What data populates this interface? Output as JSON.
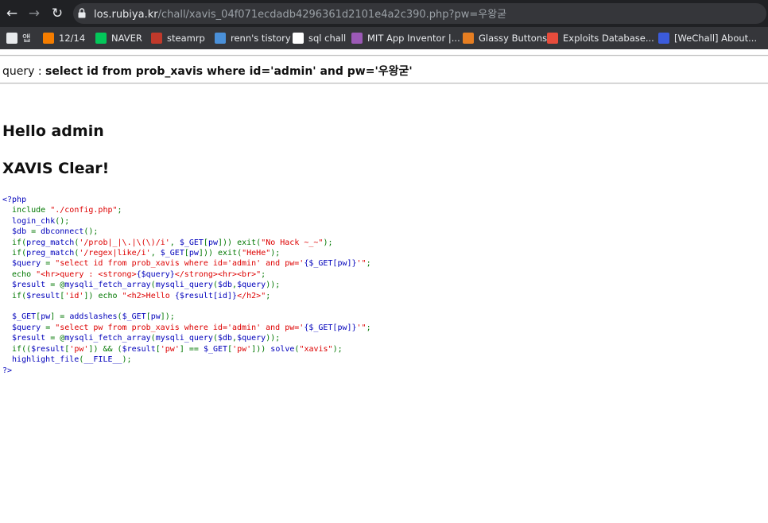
{
  "browser": {
    "nav": {
      "back": "←",
      "forward": "→",
      "reload": "↻"
    },
    "url_host": "los.rubiya.kr",
    "url_path": "/chall/xavis_04f071ecdadb4296361d2101e4a2c390.php?pw=우왕굳"
  },
  "bookmarks": [
    {
      "icon": "apps-grid-icon",
      "label": "앱",
      "color": "#e8eaed"
    },
    {
      "icon": "blogger-icon",
      "label": "12/14",
      "color": "#f57d00"
    },
    {
      "icon": "naver-icon",
      "label": "NAVER",
      "color": "#03c75a"
    },
    {
      "icon": "steam-icon",
      "label": "steamrp",
      "color": "#c0392b"
    },
    {
      "icon": "tistory-icon",
      "label": "renn's tistory",
      "color": "#4a90d9"
    },
    {
      "icon": "z-icon",
      "label": "sql chall",
      "color": "#ffffff"
    },
    {
      "icon": "mit-app-inventor-icon",
      "label": "MIT App Inventor |...",
      "color": "#9b59b6"
    },
    {
      "icon": "glassy-buttons-icon",
      "label": "Glassy Buttons",
      "color": "#e67e22"
    },
    {
      "icon": "exploit-db-icon",
      "label": "Exploits Database...",
      "color": "#e74c3c"
    },
    {
      "icon": "wechall-icon",
      "label": "[WeChall] About...",
      "color": "#3b5bdb"
    }
  ],
  "page": {
    "query_label": "query : ",
    "query_value": "select id from prob_xavis where id='admin' and pw='우왕굳'",
    "hello": "Hello admin",
    "clear": "XAVIS Clear!"
  },
  "source": {
    "lines": [
      [
        {
          "t": "<?php",
          "c": "def"
        }
      ],
      [
        {
          "t": "  include ",
          "c": "key"
        },
        {
          "t": "\"./config.php\"",
          "c": "str"
        },
        {
          "t": ";",
          "c": "key"
        }
      ],
      [
        {
          "t": "  login_chk",
          "c": "def"
        },
        {
          "t": "();",
          "c": "key"
        }
      ],
      [
        {
          "t": "  $db ",
          "c": "def"
        },
        {
          "t": "= ",
          "c": "key"
        },
        {
          "t": "dbconnect",
          "c": "def"
        },
        {
          "t": "();",
          "c": "key"
        }
      ],
      [
        {
          "t": "  if",
          "c": "key"
        },
        {
          "t": "(",
          "c": "key"
        },
        {
          "t": "preg_match",
          "c": "def"
        },
        {
          "t": "(",
          "c": "key"
        },
        {
          "t": "'/prob|_|\\.|\\(\\)/i'",
          "c": "str"
        },
        {
          "t": ", ",
          "c": "key"
        },
        {
          "t": "$_GET",
          "c": "def"
        },
        {
          "t": "[",
          "c": "key"
        },
        {
          "t": "pw",
          "c": "def"
        },
        {
          "t": "])) exit(",
          "c": "key"
        },
        {
          "t": "\"No Hack ~_~\"",
          "c": "str"
        },
        {
          "t": ");",
          "c": "key"
        }
      ],
      [
        {
          "t": "  if",
          "c": "key"
        },
        {
          "t": "(",
          "c": "key"
        },
        {
          "t": "preg_match",
          "c": "def"
        },
        {
          "t": "(",
          "c": "key"
        },
        {
          "t": "'/regex|like/i'",
          "c": "str"
        },
        {
          "t": ", ",
          "c": "key"
        },
        {
          "t": "$_GET",
          "c": "def"
        },
        {
          "t": "[",
          "c": "key"
        },
        {
          "t": "pw",
          "c": "def"
        },
        {
          "t": "])) exit(",
          "c": "key"
        },
        {
          "t": "\"HeHe\"",
          "c": "str"
        },
        {
          "t": ");",
          "c": "key"
        }
      ],
      [
        {
          "t": "  $query ",
          "c": "def"
        },
        {
          "t": "= ",
          "c": "key"
        },
        {
          "t": "\"select id from prob_xavis where id='admin' and pw='",
          "c": "str"
        },
        {
          "t": "{$_GET[pw]}",
          "c": "def"
        },
        {
          "t": "'\"",
          "c": "str"
        },
        {
          "t": ";",
          "c": "key"
        }
      ],
      [
        {
          "t": "  echo ",
          "c": "key"
        },
        {
          "t": "\"<hr>query : <strong>",
          "c": "str"
        },
        {
          "t": "{$query}",
          "c": "def"
        },
        {
          "t": "</strong><hr><br>\"",
          "c": "str"
        },
        {
          "t": ";",
          "c": "key"
        }
      ],
      [
        {
          "t": "  $result ",
          "c": "def"
        },
        {
          "t": "= @",
          "c": "key"
        },
        {
          "t": "mysqli_fetch_array",
          "c": "def"
        },
        {
          "t": "(",
          "c": "key"
        },
        {
          "t": "mysqli_query",
          "c": "def"
        },
        {
          "t": "(",
          "c": "key"
        },
        {
          "t": "$db",
          "c": "def"
        },
        {
          "t": ",",
          "c": "key"
        },
        {
          "t": "$query",
          "c": "def"
        },
        {
          "t": "));",
          "c": "key"
        }
      ],
      [
        {
          "t": "  if",
          "c": "key"
        },
        {
          "t": "(",
          "c": "key"
        },
        {
          "t": "$result",
          "c": "def"
        },
        {
          "t": "[",
          "c": "key"
        },
        {
          "t": "'id'",
          "c": "str"
        },
        {
          "t": "]) echo ",
          "c": "key"
        },
        {
          "t": "\"<h2>Hello ",
          "c": "str"
        },
        {
          "t": "{$result[id]}",
          "c": "def"
        },
        {
          "t": "</h2>\"",
          "c": "str"
        },
        {
          "t": ";",
          "c": "key"
        }
      ],
      [
        {
          "t": "",
          "c": "def"
        }
      ],
      [
        {
          "t": "  $_GET",
          "c": "def"
        },
        {
          "t": "[",
          "c": "key"
        },
        {
          "t": "pw",
          "c": "def"
        },
        {
          "t": "] = ",
          "c": "key"
        },
        {
          "t": "addslashes",
          "c": "def"
        },
        {
          "t": "(",
          "c": "key"
        },
        {
          "t": "$_GET",
          "c": "def"
        },
        {
          "t": "[",
          "c": "key"
        },
        {
          "t": "pw",
          "c": "def"
        },
        {
          "t": "]);",
          "c": "key"
        }
      ],
      [
        {
          "t": "  $query ",
          "c": "def"
        },
        {
          "t": "= ",
          "c": "key"
        },
        {
          "t": "\"select pw from prob_xavis where id='admin' and pw='",
          "c": "str"
        },
        {
          "t": "{$_GET[pw]}",
          "c": "def"
        },
        {
          "t": "'\"",
          "c": "str"
        },
        {
          "t": ";",
          "c": "key"
        }
      ],
      [
        {
          "t": "  $result ",
          "c": "def"
        },
        {
          "t": "= @",
          "c": "key"
        },
        {
          "t": "mysqli_fetch_array",
          "c": "def"
        },
        {
          "t": "(",
          "c": "key"
        },
        {
          "t": "mysqli_query",
          "c": "def"
        },
        {
          "t": "(",
          "c": "key"
        },
        {
          "t": "$db",
          "c": "def"
        },
        {
          "t": ",",
          "c": "key"
        },
        {
          "t": "$query",
          "c": "def"
        },
        {
          "t": "));",
          "c": "key"
        }
      ],
      [
        {
          "t": "  if",
          "c": "key"
        },
        {
          "t": "((",
          "c": "key"
        },
        {
          "t": "$result",
          "c": "def"
        },
        {
          "t": "[",
          "c": "key"
        },
        {
          "t": "'pw'",
          "c": "str"
        },
        {
          "t": "]) && (",
          "c": "key"
        },
        {
          "t": "$result",
          "c": "def"
        },
        {
          "t": "[",
          "c": "key"
        },
        {
          "t": "'pw'",
          "c": "str"
        },
        {
          "t": "] == ",
          "c": "key"
        },
        {
          "t": "$_GET",
          "c": "def"
        },
        {
          "t": "[",
          "c": "key"
        },
        {
          "t": "'pw'",
          "c": "str"
        },
        {
          "t": "])) ",
          "c": "key"
        },
        {
          "t": "solve",
          "c": "def"
        },
        {
          "t": "(",
          "c": "key"
        },
        {
          "t": "\"xavis\"",
          "c": "str"
        },
        {
          "t": ");",
          "c": "key"
        }
      ],
      [
        {
          "t": "  highlight_file",
          "c": "def"
        },
        {
          "t": "(",
          "c": "key"
        },
        {
          "t": "__FILE__",
          "c": "def"
        },
        {
          "t": ");",
          "c": "key"
        }
      ],
      [
        {
          "t": "?>",
          "c": "def"
        }
      ]
    ]
  }
}
